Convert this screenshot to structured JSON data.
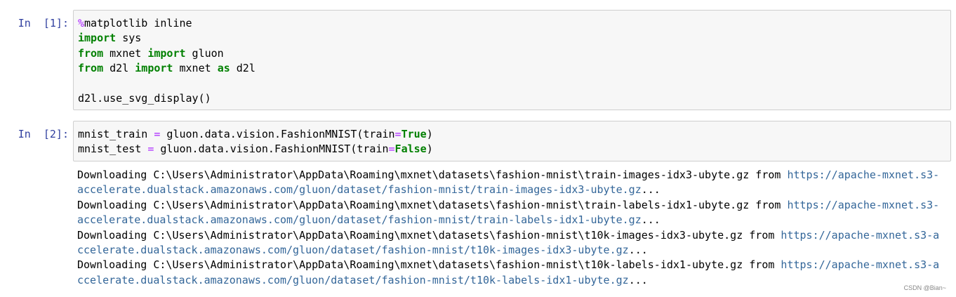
{
  "cells": [
    {
      "prompt": "In  [1]:",
      "lines": [
        [
          {
            "t": "%",
            "c": "magic"
          },
          {
            "t": "matplotlib inline",
            "c": ""
          }
        ],
        [
          {
            "t": "import",
            "c": "kw"
          },
          {
            "t": " sys",
            "c": ""
          }
        ],
        [
          {
            "t": "from",
            "c": "kw"
          },
          {
            "t": " mxnet ",
            "c": ""
          },
          {
            "t": "import",
            "c": "kw"
          },
          {
            "t": " gluon",
            "c": ""
          }
        ],
        [
          {
            "t": "from",
            "c": "kw"
          },
          {
            "t": " d2l ",
            "c": ""
          },
          {
            "t": "import",
            "c": "kw"
          },
          {
            "t": " mxnet ",
            "c": ""
          },
          {
            "t": "as",
            "c": "kw"
          },
          {
            "t": " d2l",
            "c": ""
          }
        ],
        [
          {
            "t": "",
            "c": ""
          }
        ],
        [
          {
            "t": "d2l.use_svg_display()",
            "c": ""
          }
        ]
      ]
    },
    {
      "prompt": "In  [2]:",
      "lines": [
        [
          {
            "t": "mnist_train ",
            "c": ""
          },
          {
            "t": "=",
            "c": "op"
          },
          {
            "t": " gluon.data.vision.FashionMNIST(train",
            "c": ""
          },
          {
            "t": "=",
            "c": "op"
          },
          {
            "t": "True",
            "c": "kw"
          },
          {
            "t": ")",
            "c": ""
          }
        ],
        [
          {
            "t": "mnist_test ",
            "c": ""
          },
          {
            "t": "=",
            "c": "op"
          },
          {
            "t": " gluon.data.vision.FashionMNIST(train",
            "c": ""
          },
          {
            "t": "=",
            "c": "op"
          },
          {
            "t": "False",
            "c": "kw"
          },
          {
            "t": ")",
            "c": ""
          }
        ]
      ],
      "output": [
        [
          {
            "t": "Downloading C:\\Users\\Administrator\\AppData\\Roaming\\mxnet\\datasets\\fashion-mnist\\train-images-idx3-ubyte.gz from ",
            "c": ""
          },
          {
            "t": "https://apache-mxnet.s3-",
            "c": "link"
          }
        ],
        [
          {
            "t": "accelerate.dualstack.amazonaws.com/gluon/dataset/fashion-mnist/train-images-idx3-ubyte.gz",
            "c": "link"
          },
          {
            "t": "...",
            "c": ""
          }
        ],
        [
          {
            "t": "Downloading C:\\Users\\Administrator\\AppData\\Roaming\\mxnet\\datasets\\fashion-mnist\\train-labels-idx1-ubyte.gz from ",
            "c": ""
          },
          {
            "t": "https://apache-mxnet.s3-",
            "c": "link"
          }
        ],
        [
          {
            "t": "accelerate.dualstack.amazonaws.com/gluon/dataset/fashion-mnist/train-labels-idx1-ubyte.gz",
            "c": "link"
          },
          {
            "t": "...",
            "c": ""
          }
        ],
        [
          {
            "t": "Downloading C:\\Users\\Administrator\\AppData\\Roaming\\mxnet\\datasets\\fashion-mnist\\t10k-images-idx3-ubyte.gz from ",
            "c": ""
          },
          {
            "t": "https://apache-mxnet.s3-a",
            "c": "link"
          }
        ],
        [
          {
            "t": "ccelerate.dualstack.amazonaws.com/gluon/dataset/fashion-mnist/t10k-images-idx3-ubyte.gz",
            "c": "link"
          },
          {
            "t": "...",
            "c": ""
          }
        ],
        [
          {
            "t": "Downloading C:\\Users\\Administrator\\AppData\\Roaming\\mxnet\\datasets\\fashion-mnist\\t10k-labels-idx1-ubyte.gz from ",
            "c": ""
          },
          {
            "t": "https://apache-mxnet.s3-a",
            "c": "link"
          }
        ],
        [
          {
            "t": "ccelerate.dualstack.amazonaws.com/gluon/dataset/fashion-mnist/t10k-labels-idx1-ubyte.gz",
            "c": "link"
          },
          {
            "t": "...",
            "c": ""
          }
        ]
      ]
    }
  ],
  "watermark": "CSDN @Bian~",
  "colors": {
    "prompt": "#303f9f",
    "keyword": "#008000",
    "magic": "#aa22ff",
    "link": "#336699",
    "input_bg": "#f7f7f7",
    "input_border": "#cfcfcf"
  }
}
